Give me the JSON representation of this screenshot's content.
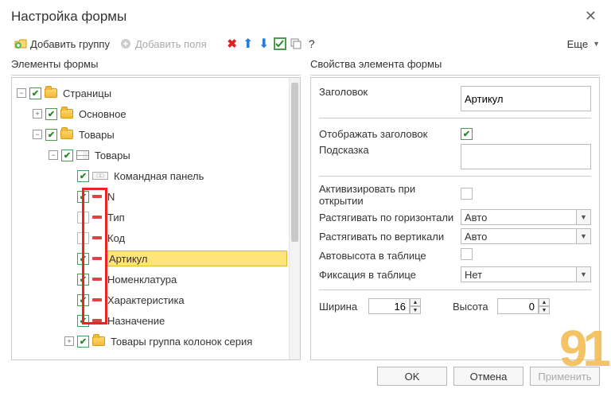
{
  "title": "Настройка формы",
  "toolbar": {
    "add_group": "Добавить группу",
    "add_fields": "Добавить поля",
    "more": "Еще"
  },
  "left_title": "Элементы формы",
  "right_title": "Свойства элемента формы",
  "tree": {
    "pages": "Страницы",
    "main": "Основное",
    "goods": "Товары",
    "goods_table": "Товары",
    "cmd": "Командная панель",
    "n": "N",
    "type": "Тип",
    "code": "Код",
    "art": "Артикул",
    "nom": "Номенклатура",
    "char": "Характеристика",
    "purpose": "Назначение",
    "group_cols": "Товары группа колонок серия"
  },
  "props": {
    "caption_lbl": "Заголовок",
    "caption_val": "Артикул",
    "show_caption_lbl": "Отображать заголовок",
    "hint_lbl": "Подсказка",
    "hint_val": "",
    "activate_lbl": "Активизировать при открытии",
    "stretch_h_lbl": "Растягивать по горизонтали",
    "stretch_h_val": "Авто",
    "stretch_v_lbl": "Растягивать по вертикали",
    "stretch_v_val": "Авто",
    "autoheight_lbl": "Автовысота в таблице",
    "fixation_lbl": "Фиксация в таблице",
    "fixation_val": "Нет",
    "width_lbl": "Ширина",
    "width_val": "16",
    "height_lbl": "Высота",
    "height_val": "0"
  },
  "buttons": {
    "ok": "OK",
    "cancel": "Отмена",
    "apply": "Применить"
  },
  "question": "?"
}
